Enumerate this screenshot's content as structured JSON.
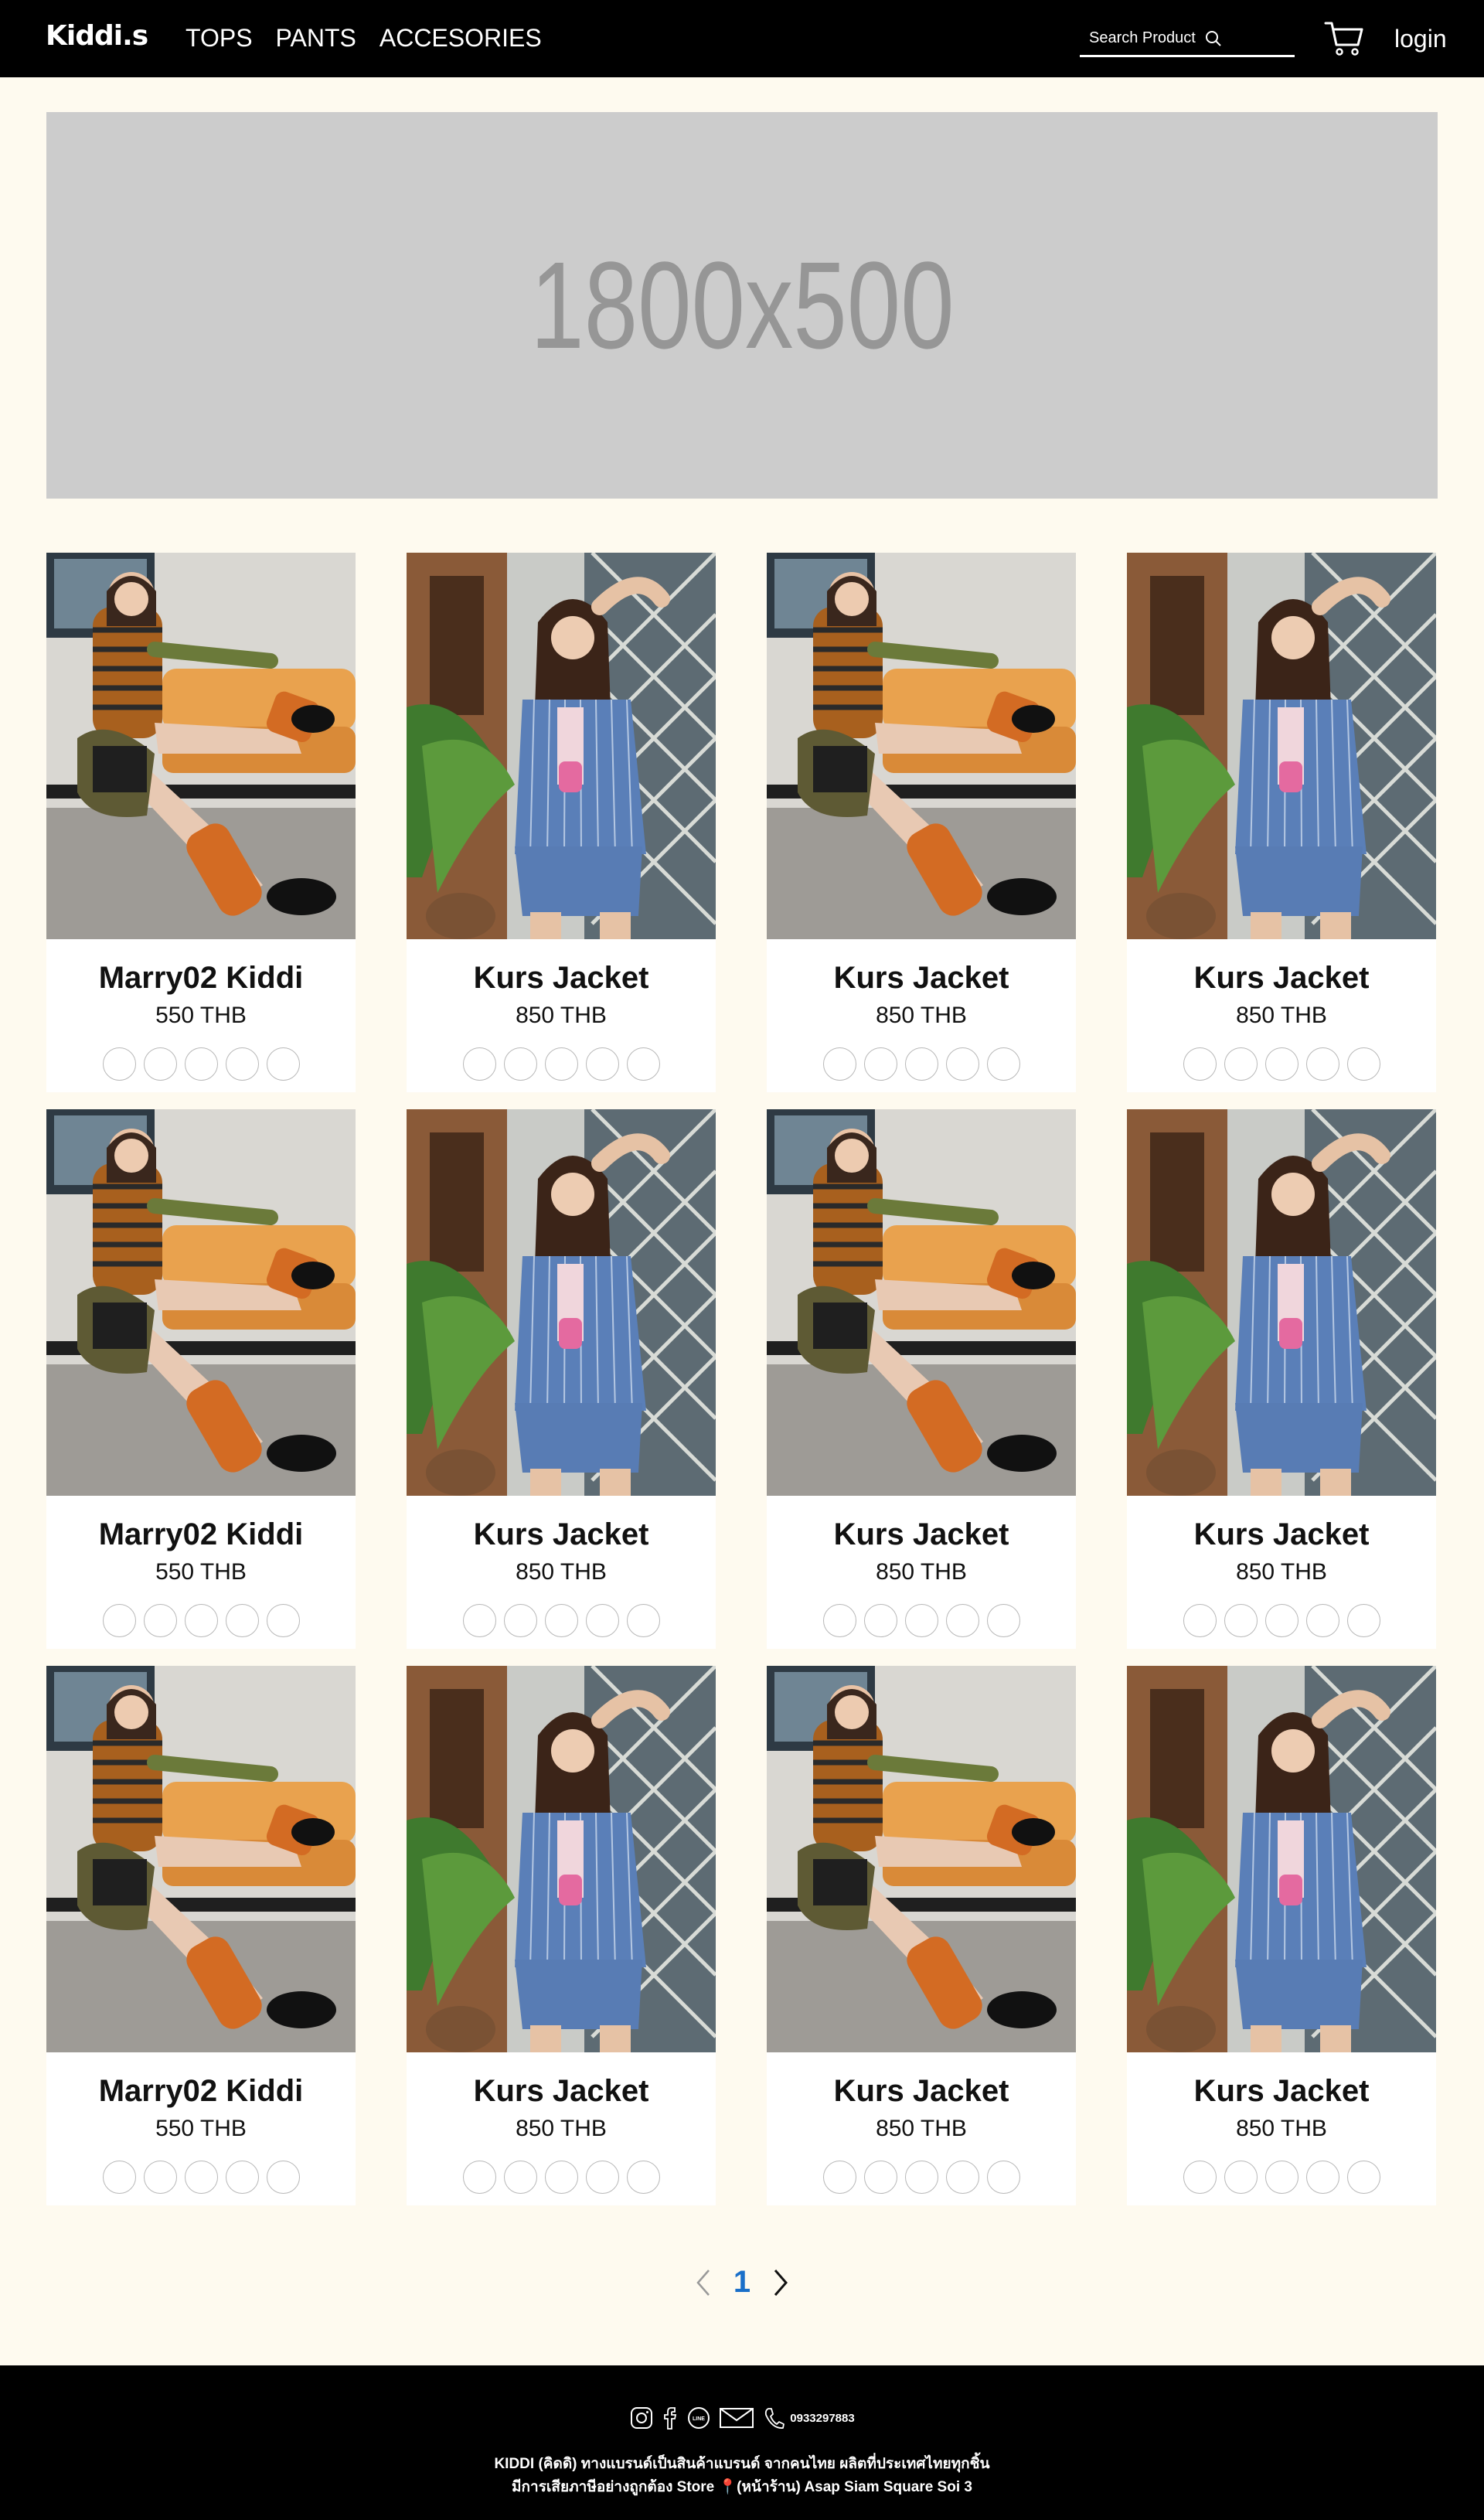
{
  "brand": "Kiddi.s",
  "nav": [
    "TOPS",
    "PANTS",
    "ACCESORIES"
  ],
  "search": {
    "placeholder": "Search Product"
  },
  "login": "login",
  "banner": {
    "text": "1800x500"
  },
  "products": [
    {
      "name": "Marry02 Kiddi",
      "price": "550 THB",
      "image": "striped-top-photo"
    },
    {
      "name": "Kurs Jacket",
      "price": "850 THB",
      "image": "denim-jacket-photo"
    },
    {
      "name": "Kurs Jacket",
      "price": "850 THB",
      "image": "striped-top-photo"
    },
    {
      "name": "Kurs Jacket",
      "price": "850 THB",
      "image": "denim-jacket-photo"
    },
    {
      "name": "Marry02 Kiddi",
      "price": "550 THB",
      "image": "striped-top-photo"
    },
    {
      "name": "Kurs Jacket",
      "price": "850 THB",
      "image": "denim-jacket-photo"
    },
    {
      "name": "Kurs Jacket",
      "price": "850 THB",
      "image": "striped-top-photo"
    },
    {
      "name": "Kurs Jacket",
      "price": "850 THB",
      "image": "denim-jacket-photo"
    },
    {
      "name": "Marry02 Kiddi",
      "price": "550 THB",
      "image": "striped-top-photo"
    },
    {
      "name": "Kurs Jacket",
      "price": "850 THB",
      "image": "denim-jacket-photo"
    },
    {
      "name": "Kurs Jacket",
      "price": "850 THB",
      "image": "striped-top-photo"
    },
    {
      "name": "Kurs Jacket",
      "price": "850 THB",
      "image": "denim-jacket-photo"
    }
  ],
  "swatch_count": 5,
  "pagination": {
    "current": "1"
  },
  "footer": {
    "phone": "0933297883",
    "line1": "KIDDI (คิดดิ) ทางแบรนด์เป็นสินค้าแบรนด์ จากคนไทย ผลิตที่ประเทศไทยทุกชิ้น",
    "line2": "มีการเสียภาษีอย่างถูกต้อง Store 📍(หน้าร้าน) Asap Siam Square Soi 3"
  },
  "colors": {
    "header": "#000000",
    "page": "#fefaef",
    "accent": "#1a6fc9",
    "banner": "#cccccc"
  }
}
